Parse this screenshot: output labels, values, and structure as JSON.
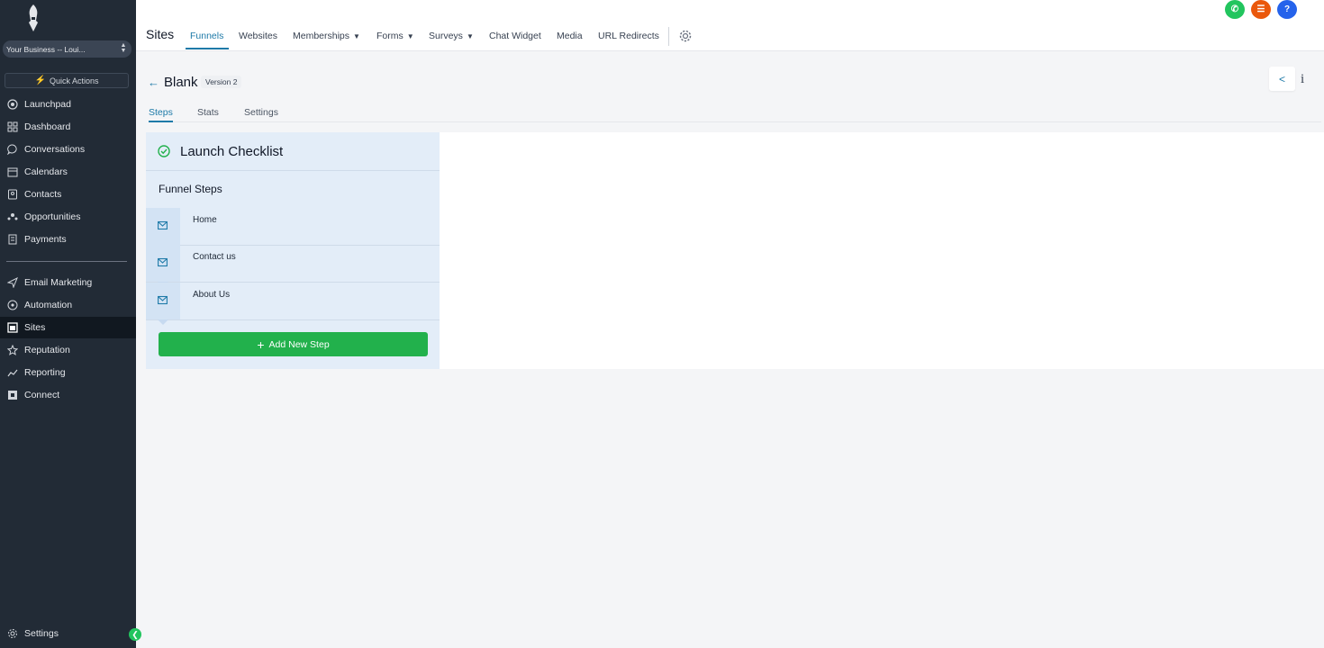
{
  "colors": {
    "sidebar_bg": "#222b36",
    "accent": "#1e7aa8",
    "success": "#22b14c",
    "phone": "#22c55e",
    "list": "#ea580c",
    "help": "#2563eb"
  },
  "sidebar": {
    "business": "Your Business -- Loui...",
    "quick_actions": "Quick Actions",
    "items": [
      {
        "label": "Launchpad",
        "icon": "launchpad-icon"
      },
      {
        "label": "Dashboard",
        "icon": "dashboard-icon"
      },
      {
        "label": "Conversations",
        "icon": "chat-icon"
      },
      {
        "label": "Calendars",
        "icon": "calendar-icon"
      },
      {
        "label": "Contacts",
        "icon": "contacts-icon"
      },
      {
        "label": "Opportunities",
        "icon": "opportunities-icon"
      },
      {
        "label": "Payments",
        "icon": "payments-icon"
      },
      {
        "label": "Email Marketing",
        "icon": "send-icon"
      },
      {
        "label": "Automation",
        "icon": "automation-icon"
      },
      {
        "label": "Sites",
        "icon": "sites-icon",
        "active": true
      },
      {
        "label": "Reputation",
        "icon": "star-icon"
      },
      {
        "label": "Reporting",
        "icon": "trend-icon"
      },
      {
        "label": "Connect",
        "icon": "connect-icon"
      }
    ],
    "settings": "Settings"
  },
  "header": {
    "title": "Sites",
    "tabs": [
      {
        "label": "Funnels",
        "active": true
      },
      {
        "label": "Websites"
      },
      {
        "label": "Memberships",
        "dropdown": true
      },
      {
        "label": "Forms",
        "dropdown": true
      },
      {
        "label": "Surveys",
        "dropdown": true
      },
      {
        "label": "Chat Widget"
      },
      {
        "label": "Media"
      },
      {
        "label": "URL Redirects"
      }
    ]
  },
  "funnel": {
    "name": "Blank",
    "version": "Version 2",
    "subtabs": [
      "Steps",
      "Stats",
      "Settings"
    ]
  },
  "panel": {
    "checklist_title": "Launch Checklist",
    "steps_title": "Funnel Steps",
    "steps": [
      "Home",
      "Contact us",
      "About Us"
    ],
    "add_step": "Add New Step"
  }
}
